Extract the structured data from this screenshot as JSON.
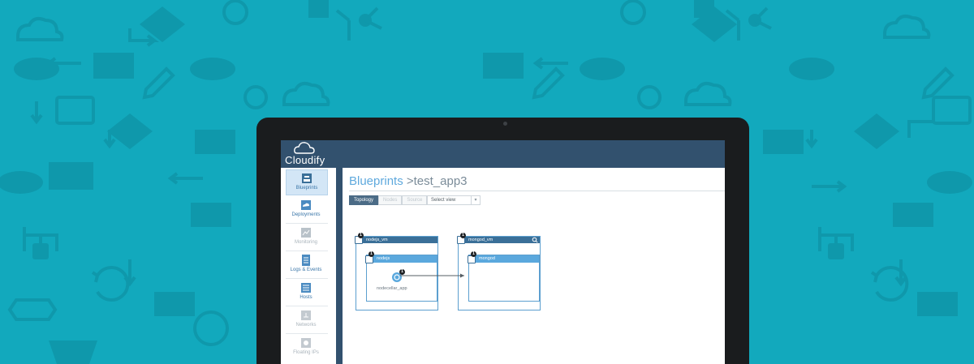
{
  "colors": {
    "background": "#12a9bd",
    "pattern": "#0f98ab",
    "topbar": "#32516e",
    "accent": "#5fa9dd",
    "node_header": "#3a6f98",
    "inner_header": "#5aa8dd"
  },
  "app": {
    "logo_text": "Cloudify"
  },
  "sidebar": {
    "items": [
      {
        "label": "Blueprints",
        "icon": "blueprints-icon",
        "active": true,
        "enabled": true
      },
      {
        "label": "Deployments",
        "icon": "deployments-icon",
        "active": false,
        "enabled": true
      },
      {
        "label": "Monitoring",
        "icon": "monitoring-icon",
        "active": false,
        "enabled": false
      },
      {
        "label": "Logs & Events",
        "icon": "logs-icon",
        "active": false,
        "enabled": true
      },
      {
        "label": "Hosts",
        "icon": "hosts-icon",
        "active": false,
        "enabled": true
      },
      {
        "label": "Networks",
        "icon": "networks-icon",
        "active": false,
        "enabled": false
      },
      {
        "label": "Floating IPs",
        "icon": "floating-ips-icon",
        "active": false,
        "enabled": false
      }
    ]
  },
  "page": {
    "breadcrumb": "Blueprints",
    "title": " >test_app3"
  },
  "view_tabs": [
    {
      "label": "Topology",
      "active": true
    },
    {
      "label": "Nodes",
      "active": false
    },
    {
      "label": "Source",
      "active": false
    }
  ],
  "view_select": {
    "value": "Select view"
  },
  "topology": {
    "nodes": [
      {
        "name": "nodejs_vm",
        "instances": "1",
        "children": [
          {
            "name": "nodejs",
            "instances": "1"
          }
        ],
        "app": {
          "name": "nodecellar_app",
          "instances": "1"
        }
      },
      {
        "name": "mongod_vm",
        "instances": "1",
        "children": [
          {
            "name": "mongod",
            "instances": "1"
          }
        ]
      }
    ]
  }
}
